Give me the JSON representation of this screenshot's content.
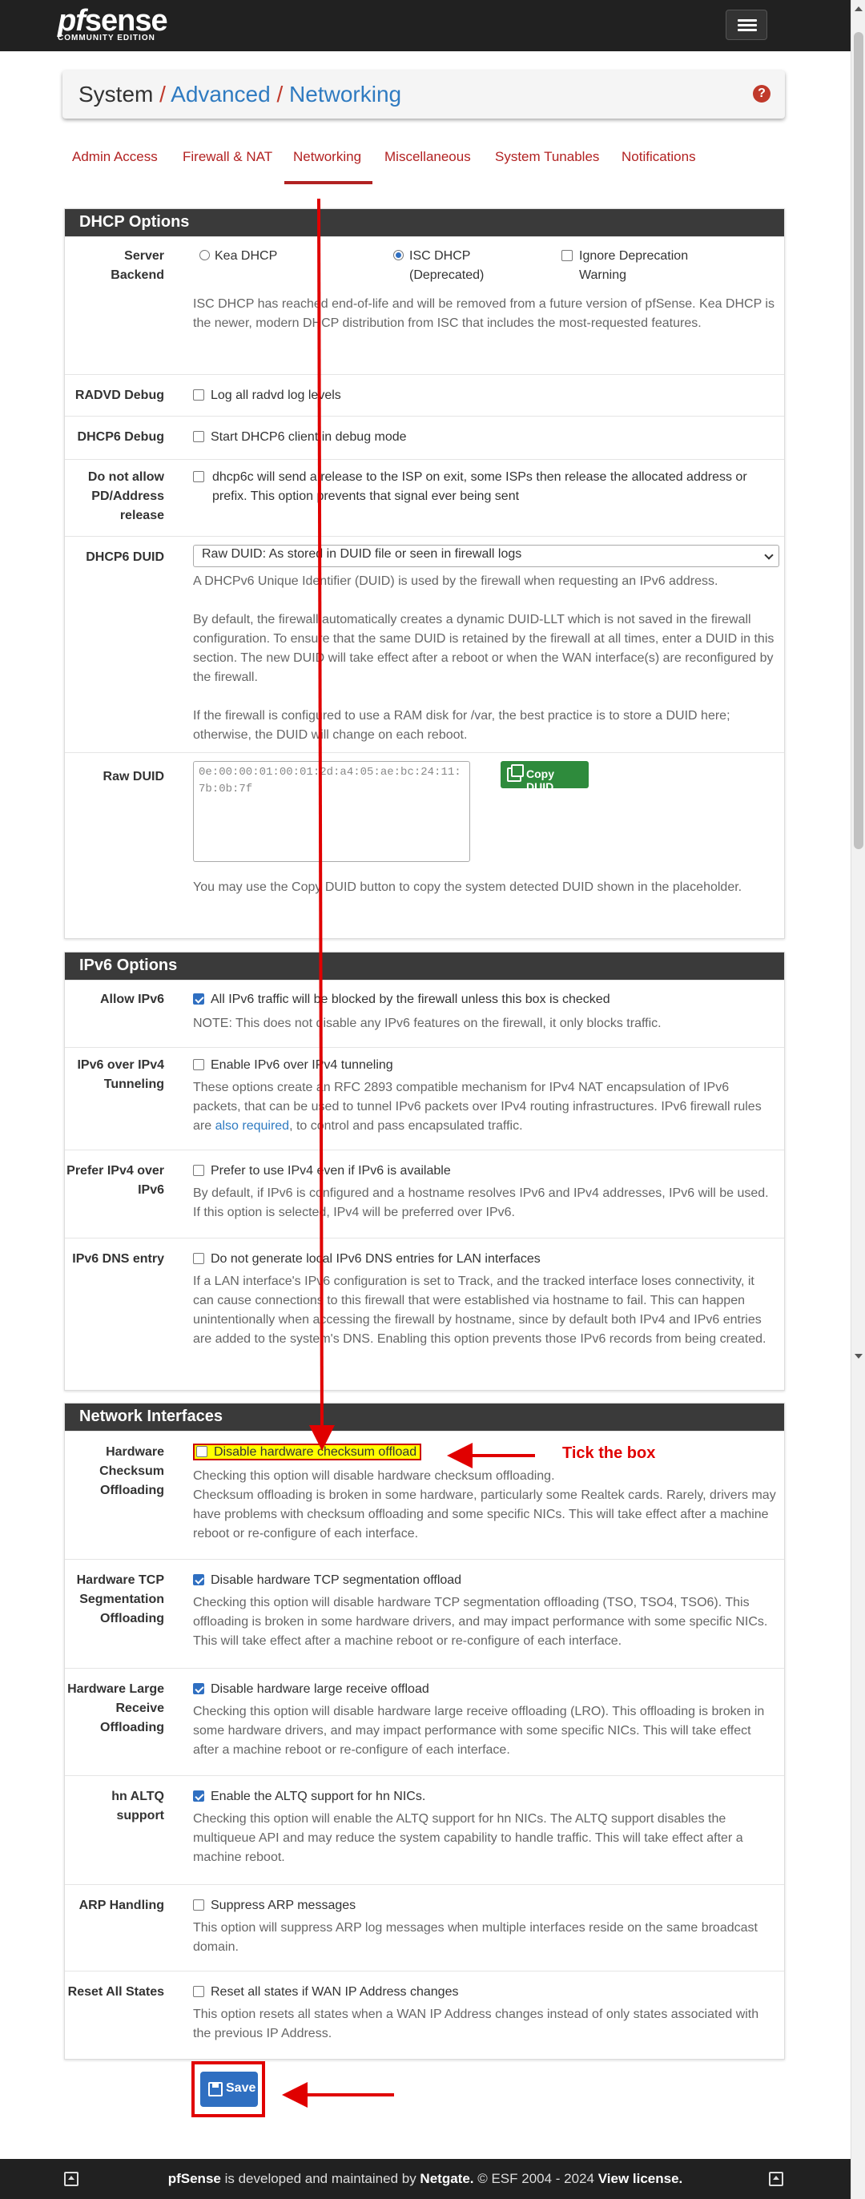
{
  "brand": {
    "logo_prefix": "pf",
    "logo_suffix": "sense",
    "logo_edition": "COMMUNITY EDITION"
  },
  "breadcrumb": {
    "root": "System",
    "level1": "Advanced",
    "level2": "Networking",
    "separator": "/",
    "help_glyph": "?"
  },
  "tabs": [
    {
      "label": "Admin Access"
    },
    {
      "label": "Firewall & NAT"
    },
    {
      "label": "Networking"
    },
    {
      "label": "Miscellaneous"
    },
    {
      "label": "System Tunables"
    },
    {
      "label": "Notifications"
    }
  ],
  "dhcp": {
    "title": "DHCP Options",
    "server_backend": {
      "label": "Server Backend",
      "opt_kea": "Kea DHCP",
      "opt_isc": "ISC DHCP (Deprecated)",
      "opt_ignore": "Ignore Deprecation Warning",
      "help": "ISC DHCP has reached end-of-life and will be removed from a future version of pfSense. Kea DHCP is the newer, modern DHCP distribution from ISC that includes the most-requested features."
    },
    "radvd_debug": {
      "label": "RADVD Debug",
      "checkbox": "Log all radvd log levels"
    },
    "dhcp6_debug": {
      "label": "DHCP6 Debug",
      "checkbox": "Start DHCP6 client in debug mode"
    },
    "no_release": {
      "label": "Do not allow PD/Address release",
      "checkbox": "dhcp6c will send a release to the ISP on exit, some ISPs then release the allocated address or prefix. This option prevents that signal ever being sent"
    },
    "duid": {
      "label": "DHCP6 DUID",
      "selected": "Raw DUID: As stored in DUID file or seen in firewall logs",
      "help1": "A DHCPv6 Unique Identifier (DUID) is used by the firewall when requesting an IPv6 address.",
      "help2": "By default, the firewall automatically creates a dynamic DUID-LLT which is not saved in the firewall configuration. To ensure that the same DUID is retained by the firewall at all times, enter a DUID in this section. The new DUID will take effect after a reboot or when the WAN interface(s) are reconfigured by the firewall.",
      "help3": "If the firewall is configured to use a RAM disk for /var, the best practice is to store a DUID here; otherwise, the DUID will change on each reboot."
    },
    "raw_duid": {
      "label": "Raw DUID",
      "placeholder": "0e:00:00:01:00:01:2d:a4:05:ae:bc:24:11:7b:0b:7f",
      "copy_button": "Copy DUID",
      "help": "You may use the Copy DUID button to copy the system detected DUID shown in the placeholder."
    }
  },
  "ipv6": {
    "title": "IPv6 Options",
    "allow": {
      "label": "Allow IPv6",
      "checkbox": "All IPv6 traffic will be blocked by the firewall unless this box is checked",
      "help": "NOTE: This does not disable any IPv6 features on the firewall, it only blocks traffic."
    },
    "tunnel": {
      "label": "IPv6 over IPv4 Tunneling",
      "checkbox": "Enable IPv6 over IPv4 tunneling",
      "help_a": "These options create an RFC 2893 compatible mechanism for IPv4 NAT encapsulation of IPv6 packets, that can be used to tunnel IPv6 packets over IPv4 routing infrastructures. IPv6 firewall rules are ",
      "help_link": "also required",
      "help_b": ", to control and pass encapsulated traffic."
    },
    "prefer": {
      "label": "Prefer IPv4 over IPv6",
      "checkbox": "Prefer to use IPv4 even if IPv6 is available",
      "help": "By default, if IPv6 is configured and a hostname resolves IPv6 and IPv4 addresses, IPv6 will be used. If this option is selected, IPv4 will be preferred over IPv6."
    },
    "dns": {
      "label": "IPv6 DNS entry",
      "checkbox": "Do not generate local IPv6 DNS entries for LAN interfaces",
      "help": "If a LAN interface's IPv6 configuration is set to Track, and the tracked interface loses connectivity, it can cause connections to this firewall that were established via hostname to fail. This can happen unintentionally when accessing the firewall by hostname, since by default both IPv4 and IPv6 entries are added to the system's DNS. Enabling this option prevents those IPv6 records from being created."
    }
  },
  "netif": {
    "title": "Network Interfaces",
    "checksum": {
      "label": "Hardware Checksum Offloading",
      "checkbox": "Disable hardware checksum offload",
      "help1": "Checking this option will disable hardware checksum offloading.",
      "help2": "Checksum offloading is broken in some hardware, particularly some Realtek cards. Rarely, drivers may have problems with checksum offloading and some specific NICs. This will take effect after a machine reboot or re-configure of each interface."
    },
    "tso": {
      "label": "Hardware TCP Segmentation Offloading",
      "checkbox": "Disable hardware TCP segmentation offload",
      "help": "Checking this option will disable hardware TCP segmentation offloading (TSO, TSO4, TSO6). This offloading is broken in some hardware drivers, and may impact performance with some specific NICs. This will take effect after a machine reboot or re-configure of each interface."
    },
    "lro": {
      "label": "Hardware Large Receive Offloading",
      "checkbox": "Disable hardware large receive offload",
      "help": "Checking this option will disable hardware large receive offloading (LRO). This offloading is broken in some hardware drivers, and may impact performance with some specific NICs. This will take effect after a machine reboot or re-configure of each interface."
    },
    "altq": {
      "label": "hn ALTQ support",
      "checkbox": "Enable the ALTQ support for hn NICs.",
      "help": "Checking this option will enable the ALTQ support for hn NICs. The ALTQ support disables the multiqueue API and may reduce the system capability to handle traffic. This will take effect after a machine reboot."
    },
    "arp": {
      "label": "ARP Handling",
      "checkbox": "Suppress ARP messages",
      "help": "This option will suppress ARP log messages when multiple interfaces reside on the same broadcast domain."
    },
    "reset": {
      "label": "Reset All States",
      "checkbox": "Reset all states if WAN IP Address changes",
      "help": "This option resets all states when a WAN IP Address changes instead of only states associated with the previous IP Address."
    }
  },
  "save_button": "Save",
  "annotation_text": "Tick the box",
  "footer": {
    "brand": "pfSense",
    "text1": " is developed and maintained by ",
    "company": "Netgate.",
    "text2": " © ESF 2004 - 2024 ",
    "license": "View license."
  },
  "colors": {
    "accent": "#b22222",
    "link": "#2f7bc1",
    "annotation": "#e00000",
    "primary_button": "#2f6fc1",
    "copy_button": "#2e8b3c"
  }
}
